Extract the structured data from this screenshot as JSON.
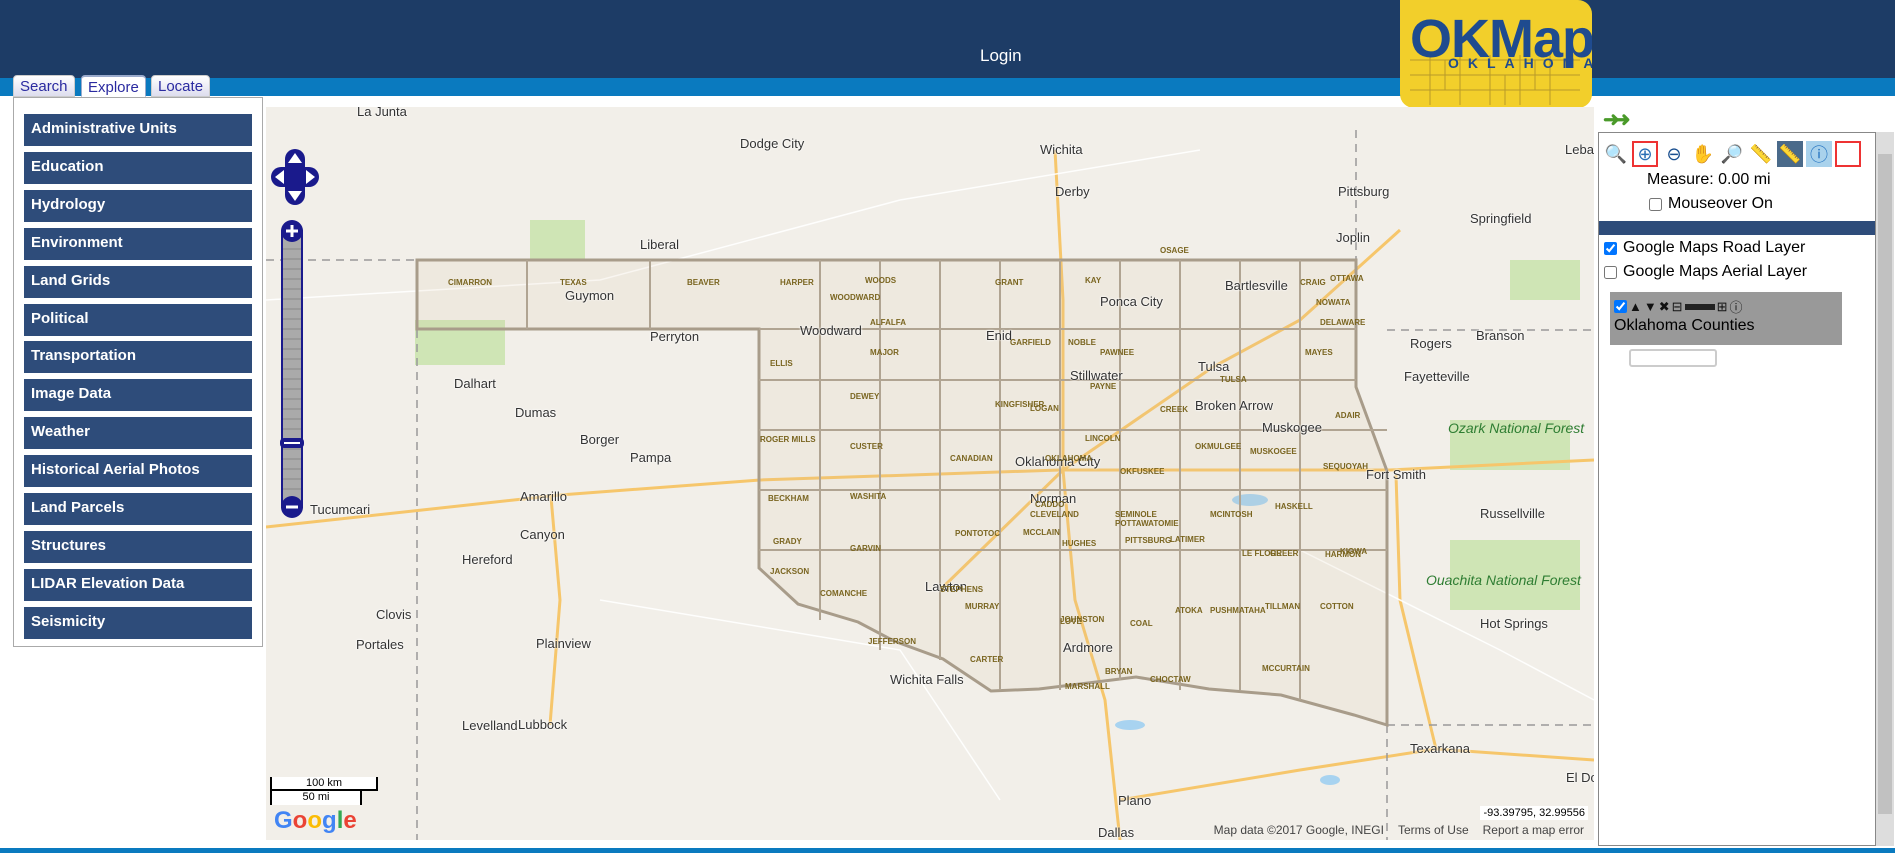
{
  "header": {
    "login_label": "Login",
    "logo_text": "OKMaps",
    "logo_subtext": "OKLAHOMA"
  },
  "tabs": [
    {
      "label": "Search"
    },
    {
      "label": "Explore",
      "active": true
    },
    {
      "label": "Locate"
    }
  ],
  "categories": [
    "Administrative Units",
    "Education",
    "Hydrology",
    "Environment",
    "Land Grids",
    "Political",
    "Transportation",
    "Image Data",
    "Weather",
    "Historical Aerial Photos",
    "Land Parcels",
    "Structures",
    "LIDAR Elevation Data",
    "Seismicity"
  ],
  "map": {
    "cities": [
      "La Junta",
      "Dodge City",
      "Wichita",
      "Derby",
      "Pittsburg",
      "Springfield",
      "Joplin",
      "Liberal",
      "Guymon",
      "Perryton",
      "Dalhart",
      "Dumas",
      "Borger",
      "Pampa",
      "Amarillo",
      "Canyon",
      "Hereford",
      "Tucumcari",
      "Clovis",
      "Portales",
      "Plainview",
      "Levelland",
      "Lubbock",
      "Wichita Falls",
      "Lawton",
      "Norman",
      "Oklahoma City",
      "Enid",
      "Woodward",
      "Stillwater",
      "Ponca City",
      "Bartlesville",
      "Tulsa",
      "Broken Arrow",
      "Muskogee",
      "Fort Smith",
      "Fayetteville",
      "Rogers",
      "Branson",
      "Russellville",
      "Hot Springs",
      "Texarkana",
      "Ardmore",
      "Plano",
      "Dallas",
      "El Do",
      "Lebanon"
    ],
    "forests": [
      "Ozark National Forest",
      "Ouachita National Forest"
    ],
    "counties": [
      "CIMARRON",
      "TEXAS",
      "BEAVER",
      "HARPER",
      "WOODS",
      "GRANT",
      "KAY",
      "OSAGE",
      "CRAIG",
      "OTTAWA",
      "WOODWARD",
      "ALFALFA",
      "GARFIELD",
      "NOBLE",
      "PAWNEE",
      "NOWATA",
      "DELAWARE",
      "ELLIS",
      "MAJOR",
      "KINGFISHER",
      "LOGAN",
      "PAYNE",
      "CREEK",
      "TULSA",
      "MAYES",
      "DEWEY",
      "ROGER MILLS",
      "CUSTER",
      "CANADIAN",
      "OKLAHOMA",
      "LINCOLN",
      "OKMULGEE",
      "MUSKOGEE",
      "ADAIR",
      "SEQUOYAH",
      "BECKHAM",
      "WASHITA",
      "CADDO",
      "MCCLAIN",
      "CLEVELAND",
      "POTTAWATOMIE",
      "SEMINOLE",
      "OKFUSKEE",
      "MCINTOSH",
      "HASKELL",
      "GREER",
      "KIOWA",
      "GRADY",
      "GARVIN",
      "PONTOTOC",
      "HUGHES",
      "PITTSBURG",
      "LATIMER",
      "LE FLORE",
      "HARMON",
      "JACKSON",
      "COMANCHE",
      "STEPHENS",
      "MURRAY",
      "JOHNSTON",
      "COAL",
      "ATOKA",
      "PUSHMATAHA",
      "TILLMAN",
      "COTTON",
      "JEFFERSON",
      "CARTER",
      "LOVE",
      "MARSHALL",
      "BRYAN",
      "CHOCTAW",
      "MCCURTAIN"
    ],
    "scale_km": "100 km",
    "scale_mi": "50 mi",
    "google_logo": "Google",
    "coordinates": "-93.39795, 32.99556",
    "attribution": [
      "Map data ©2017 Google, INEGI",
      "Terms of Use",
      "Report a map error"
    ]
  },
  "right_panel": {
    "tools": [
      "zoom-full-icon",
      "zoom-in-box-icon",
      "zoom-out-icon",
      "pan-hand-icon",
      "zoom-previous-icon",
      "measure-ruler-icon",
      "measure-area-icon",
      "info-icon",
      "select-box-icon"
    ],
    "measure_text": "Measure: 0.00 mi",
    "mouseover_label": "Mouseover On",
    "base_layers": [
      {
        "label": "Google Maps Road Layer",
        "checked": true
      },
      {
        "label": "Google Maps Aerial Layer",
        "checked": false
      }
    ],
    "overlay": {
      "name": "Oklahoma Counties",
      "checked": true
    }
  }
}
